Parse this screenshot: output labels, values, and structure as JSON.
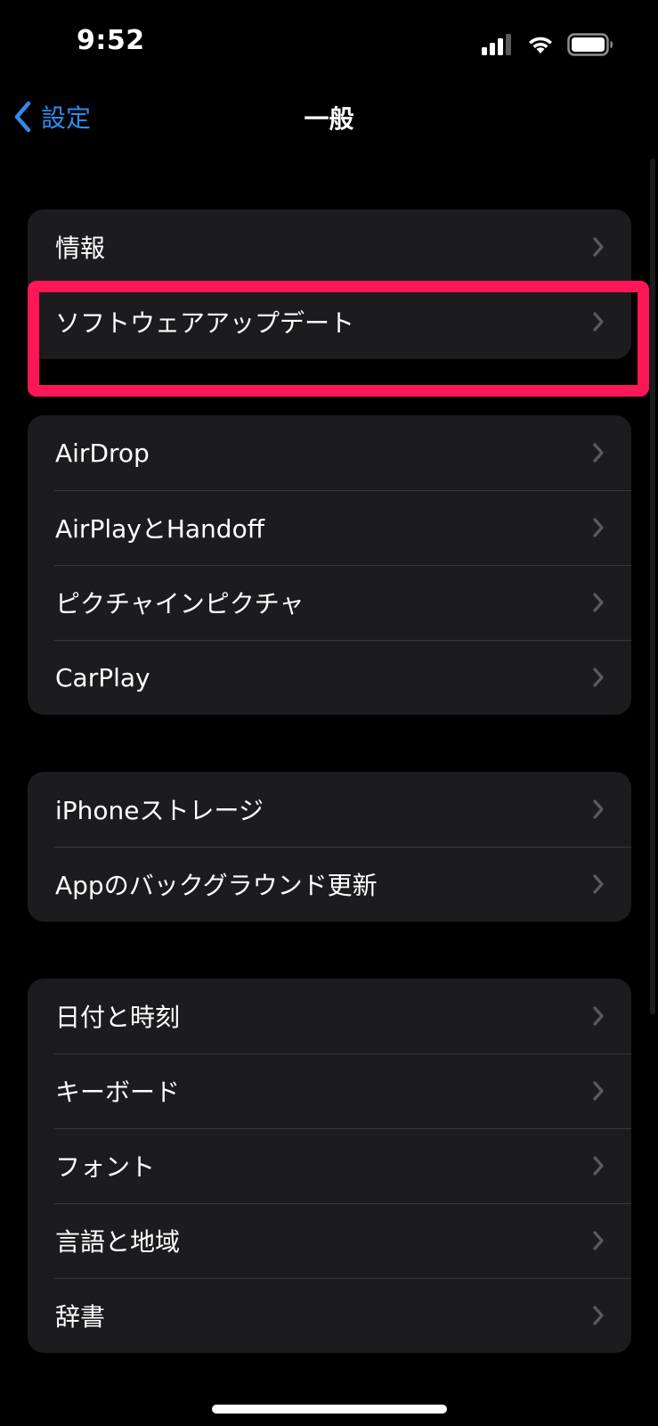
{
  "status_bar": {
    "time": "9:52",
    "icons": [
      "cellular-signal-icon",
      "wifi-icon",
      "battery-icon"
    ]
  },
  "nav": {
    "back_label": "設定",
    "title": "一般"
  },
  "groups": [
    {
      "items": [
        {
          "label": "情報"
        },
        {
          "label": "ソフトウェアアップデート",
          "highlighted": true
        }
      ]
    },
    {
      "items": [
        {
          "label": "AirDrop"
        },
        {
          "label": "AirPlayとHandoff"
        },
        {
          "label": "ピクチャインピクチャ"
        },
        {
          "label": "CarPlay"
        }
      ]
    },
    {
      "items": [
        {
          "label": "iPhoneストレージ"
        },
        {
          "label": "Appのバックグラウンド更新"
        }
      ]
    },
    {
      "items": [
        {
          "label": "日付と時刻"
        },
        {
          "label": "キーボード"
        },
        {
          "label": "フォント"
        },
        {
          "label": "言語と地域"
        },
        {
          "label": "辞書"
        }
      ]
    }
  ],
  "colors": {
    "background": "#000000",
    "cell": "#1c1c1e",
    "separator": "#38383a",
    "accent": "#2d8cf0",
    "highlight": "#ff1656",
    "chevron": "#5a5a5f"
  }
}
